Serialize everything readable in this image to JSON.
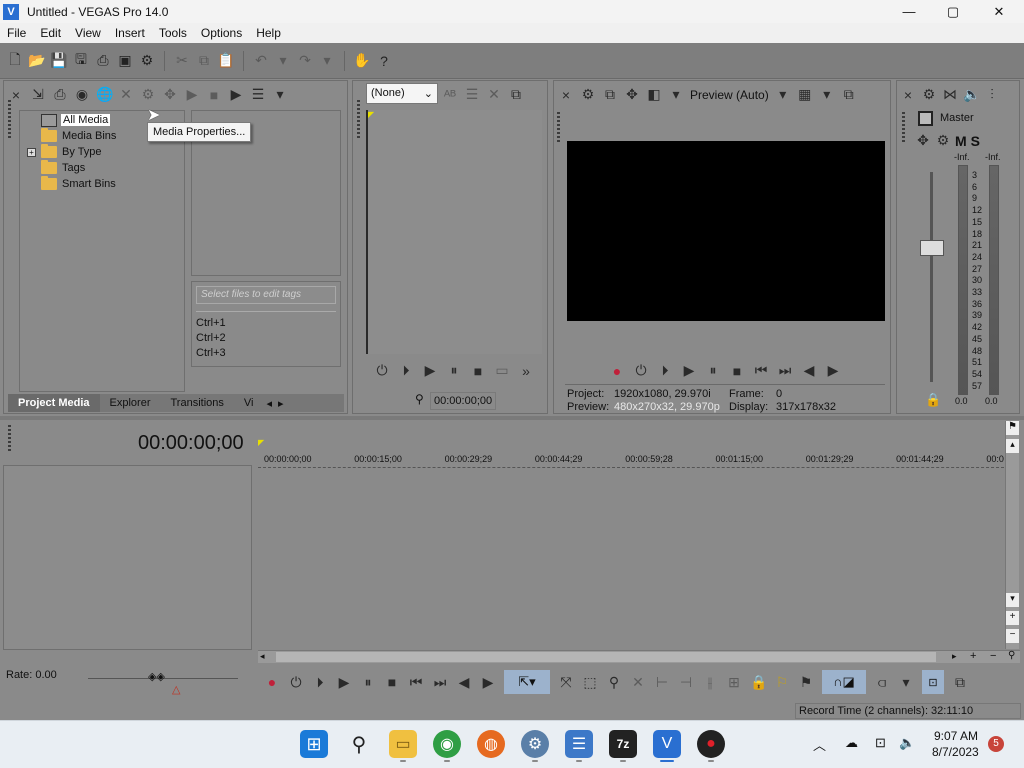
{
  "window": {
    "title": "Untitled - VEGAS Pro 14.0",
    "minimize": "—",
    "maximize": "▢",
    "close": "✕"
  },
  "menu": [
    "File",
    "Edit",
    "View",
    "Insert",
    "Tools",
    "Options",
    "Help"
  ],
  "project_media": {
    "tree": [
      {
        "label": "All Media",
        "selected": true
      },
      {
        "label": "Media Bins"
      },
      {
        "label": "By Type",
        "expander": "+"
      },
      {
        "label": "Tags"
      },
      {
        "label": "Smart Bins"
      }
    ],
    "tooltip": "Media Properties...",
    "tag_placeholder": "Select files to edit tags",
    "tag_shortcuts": [
      "Ctrl+1",
      "Ctrl+2",
      "Ctrl+3"
    ],
    "tabs": [
      "Project Media",
      "Explorer",
      "Transitions",
      "Vi"
    ]
  },
  "trimmer": {
    "dropdown_value": "(None)",
    "timecode": "00:00:00;00"
  },
  "preview": {
    "mode": "Preview (Auto)",
    "project_label": "Project:",
    "project_value": "1920x1080, 29.970i",
    "preview_label": "Preview:",
    "preview_value": "480x270x32, 29.970p",
    "frame_label": "Frame:",
    "frame_value": "0",
    "display_label": "Display:",
    "display_value": "317x178x32"
  },
  "master": {
    "title": "Master",
    "m": "M",
    "s": "S",
    "inf_left": "-Inf.",
    "inf_right": "-Inf.",
    "scale": [
      "3",
      "6",
      "9",
      "12",
      "15",
      "18",
      "21",
      "24",
      "27",
      "30",
      "33",
      "36",
      "39",
      "42",
      "45",
      "48",
      "51",
      "54",
      "57"
    ],
    "bottom_left": "0.0",
    "bottom_right": "0.0"
  },
  "timeline": {
    "timecode": "00:00:00;00",
    "ruler": [
      "00:00:00;00",
      "00:00:15;00",
      "00:00:29;29",
      "00:00:44;29",
      "00:00:59;28",
      "00:01:15;00",
      "00:01:29;29",
      "00:01:44;29",
      "00:0"
    ],
    "rate": "Rate: 0.00",
    "record_time": "Record Time (2 channels): 32:11:10"
  },
  "taskbar": {
    "time": "9:07 AM",
    "date": "8/7/2023",
    "badge": "5",
    "z7": "7z"
  }
}
